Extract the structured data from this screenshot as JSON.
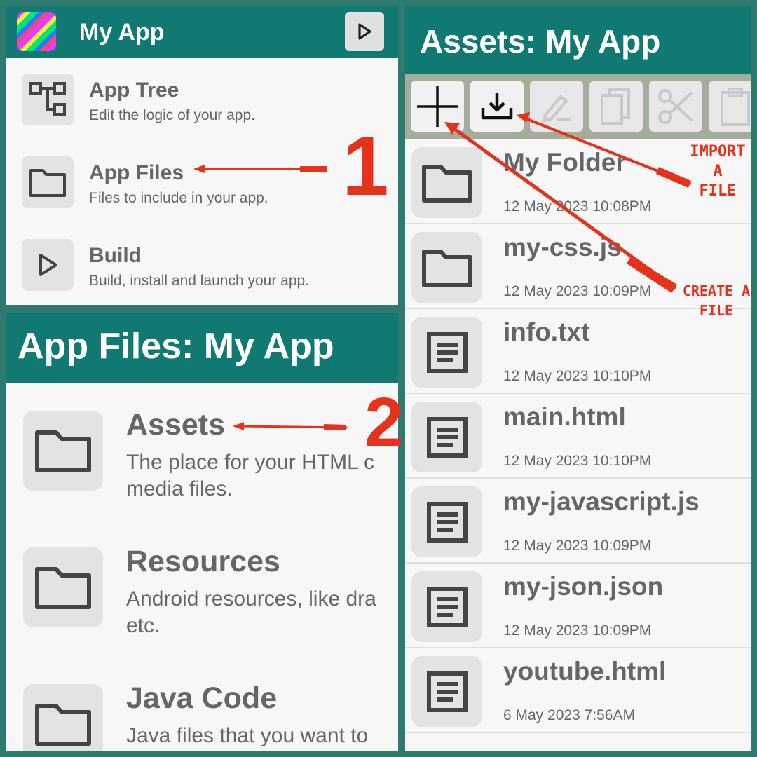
{
  "panel1": {
    "title": "My App",
    "items": [
      {
        "title": "App Tree",
        "subtitle": "Edit the logic of your app."
      },
      {
        "title": "App Files",
        "subtitle": "Files to include in your app."
      },
      {
        "title": "Build",
        "subtitle": "Build, install and launch your app."
      }
    ]
  },
  "panel2": {
    "title": "App Files: My App",
    "items": [
      {
        "title": "Assets",
        "line1": "The place for your HTML c",
        "line2": "media files."
      },
      {
        "title": "Resources",
        "line1": "Android resources, like dra",
        "line2": "etc."
      },
      {
        "title": "Java Code",
        "line1": "Java files that you want to",
        "line2": ""
      }
    ]
  },
  "panel3": {
    "title": "Assets: My App",
    "toolbar": [
      {
        "icon": "add-icon",
        "enabled": true
      },
      {
        "icon": "import-icon",
        "enabled": true
      },
      {
        "icon": "rename-icon",
        "enabled": false
      },
      {
        "icon": "copy-icon",
        "enabled": false
      },
      {
        "icon": "cut-icon",
        "enabled": false
      },
      {
        "icon": "paste-icon",
        "enabled": false
      }
    ],
    "files": [
      {
        "name": "My Folder",
        "date": "12 May 2023 10:08PM",
        "type": "folder"
      },
      {
        "name": "my-css.js",
        "date": "12 May 2023 10:09PM",
        "type": "folder"
      },
      {
        "name": "info.txt",
        "date": "12 May 2023 10:10PM",
        "type": "file"
      },
      {
        "name": "main.html",
        "date": "12 May 2023 10:10PM",
        "type": "file"
      },
      {
        "name": "my-javascript.js",
        "date": "12 May 2023 10:09PM",
        "type": "file"
      },
      {
        "name": "my-json.json",
        "date": "12 May 2023 10:09PM",
        "type": "file"
      },
      {
        "name": "youtube.html",
        "date": "6 May 2023 7:56AM",
        "type": "file"
      }
    ]
  },
  "annotations": {
    "step1": "1",
    "step2": "2",
    "import_note": [
      "IMPORT",
      "A",
      "FILE"
    ],
    "create_note": [
      "CREATE A",
      "FILE"
    ]
  },
  "colors": {
    "header": "#107a72",
    "background": "#2e7a6e",
    "toolbar": "#a4ad9c",
    "annotation": "#e4321c"
  }
}
